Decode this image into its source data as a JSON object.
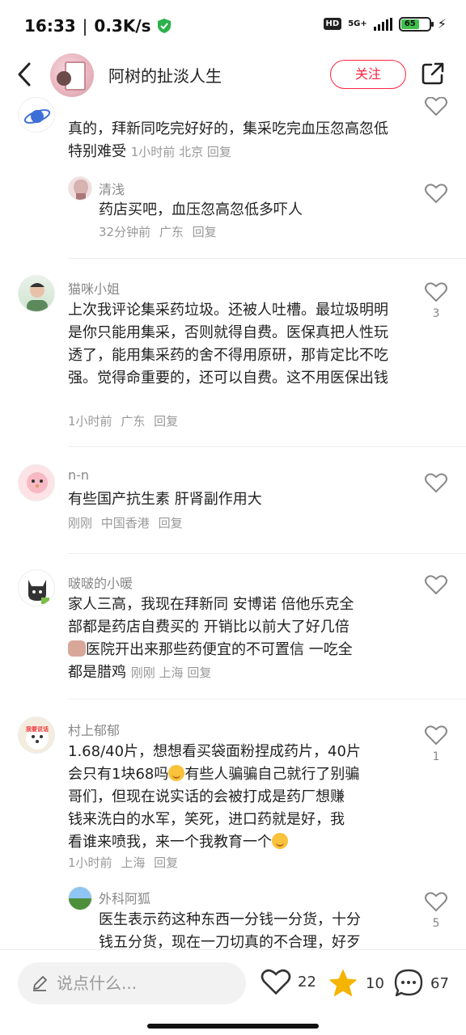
{
  "status_bar": {
    "time": "16:33",
    "speed": "0.3K/s",
    "hd": "HD",
    "network": "5G+",
    "battery": "65"
  },
  "header": {
    "title": "阿树的扯淡人生",
    "follow_label": "关注"
  },
  "comments": [
    {
      "text": "真的，拜新同吃完好好的，集采吃完血压忽高忽低特别难受",
      "time": "1小时前",
      "location": "北京",
      "reply_label": "回复",
      "sub_reply": {
        "name": "清浅",
        "text": "药店买吧，血压忽高忽低多吓人",
        "time": "32分钟前",
        "location": "广东",
        "reply_label": "回复"
      }
    },
    {
      "name": "猫咪小姐",
      "text": "上次我评论集采药垃圾。还被人吐槽。最垃圾明明是你只能用集采，否则就得自费。医保真把人性玩透了，能用集采药的舍不得用原研，那肯定比不吃强。觉得命重要的，还可以自费。这不用医保出钱",
      "time": "1小时前",
      "location": "广东",
      "reply_label": "回复",
      "likes": "3"
    },
    {
      "name": "n-n",
      "text": "有些国产抗生素 肝肾副作用大",
      "time": "刚刚",
      "location": "中国香港",
      "reply_label": "回复"
    },
    {
      "name": "啵啵的小暖",
      "text_line1": "家人三高，我现在拜新同 安博诺 倍他乐克全",
      "text_line2": "部都是药店自费买的 开销比以前大了好几倍",
      "text_line3": "医院开出来那些药便宜的不可置信 一吃全",
      "text_line4": "都是腊鸡",
      "time": "刚刚",
      "location": "上海",
      "reply_label": "回复"
    },
    {
      "name": "村上郁郁",
      "avatar_text": "我要说话",
      "text_line1": "1.68/40片，想想看买袋面粉捏成药片，40片",
      "text_line2a": "会只有1块68吗",
      "text_line2b": "有些人骗骗自己就行了别骗",
      "text_line3": "哥们，但现在说实话的会被打成是药厂想赚",
      "text_line4": "钱来洗白的水军，笑死，进口药就是好，我",
      "text_line5": "看谁来喷我，来一个我教育一个",
      "time": "1小时前",
      "location": "上海",
      "reply_label": "回复",
      "likes": "1",
      "sub_reply": {
        "name": "外科阿狐",
        "text_line1": "医生表示药这种东西一分钱一分货，十分",
        "text_line2": "钱五分货，现在一刀切真的不合理，好歹",
        "likes": "5"
      }
    }
  ],
  "bottom_bar": {
    "input_placeholder": "说点什么...",
    "likes_count": "22",
    "stars_count": "10",
    "comments_count": "67"
  },
  "colors": {
    "accent": "#ff2442",
    "star": "#f5b400"
  }
}
